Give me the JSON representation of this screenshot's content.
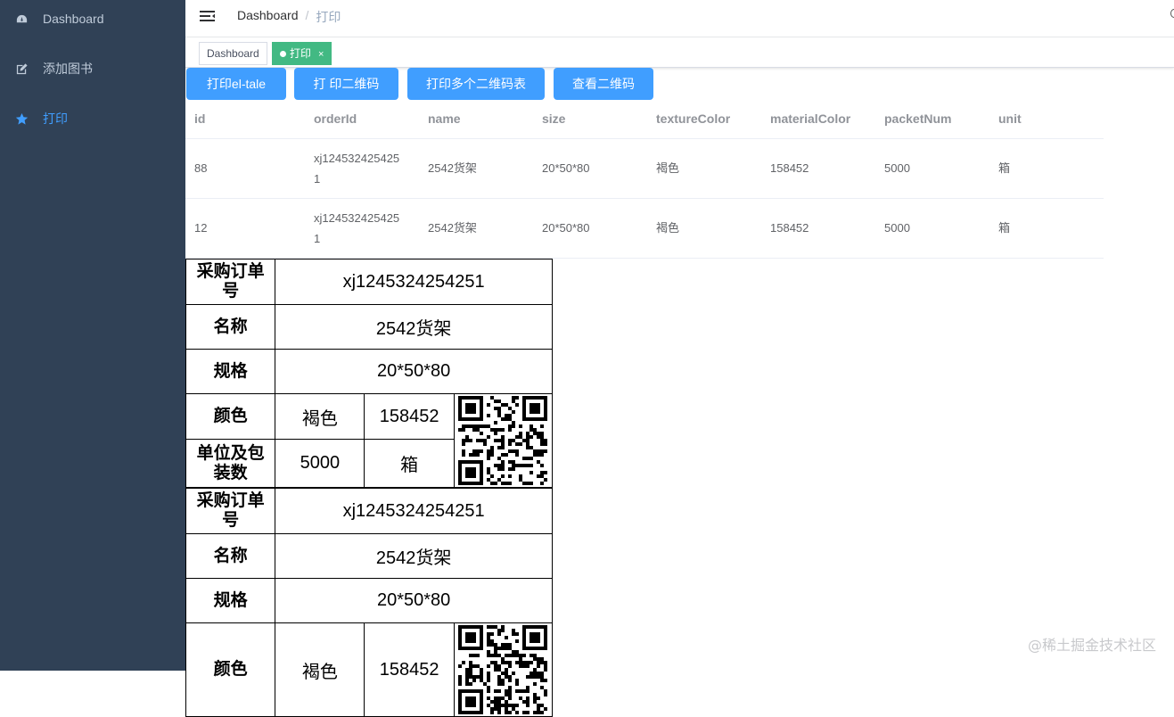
{
  "sidebar": {
    "items": [
      {
        "label": "Dashboard",
        "icon": "dashboard-icon"
      },
      {
        "label": "添加图书",
        "icon": "edit-icon"
      },
      {
        "label": "打印",
        "icon": "star-icon"
      }
    ]
  },
  "navbar": {
    "breadcrumb": [
      "Dashboard",
      "/",
      "打印"
    ]
  },
  "tags": [
    {
      "label": "Dashboard"
    },
    {
      "label": "打印",
      "close": "×"
    }
  ],
  "buttons": [
    "打印el-tale",
    "打 印二维码",
    "打印多个二维码表",
    "查看二维码"
  ],
  "table": {
    "headers": [
      "id",
      "orderId",
      "name",
      "size",
      "textureColor",
      "materialColor",
      "packetNum",
      "unit"
    ],
    "rows": [
      {
        "id": "88",
        "orderId_1": "xj124532425425",
        "orderId_2": "1",
        "name": "2542货架",
        "size": "20*50*80",
        "textureColor": "褐色",
        "materialColor": "158452",
        "packetNum": "5000",
        "unit": "箱"
      },
      {
        "id": "12",
        "orderId_1": "xj124532425425",
        "orderId_2": "1",
        "name": "2542货架",
        "size": "20*50*80",
        "textureColor": "褐色",
        "materialColor": "158452",
        "packetNum": "5000",
        "unit": "箱"
      }
    ]
  },
  "labels": [
    {
      "k_order_1": "采购订单",
      "k_order_2": "号",
      "order": "xj1245324254251",
      "k_name": "名称",
      "name": "2542货架",
      "k_size": "规格",
      "size": "20*50*80",
      "k_color": "颜色",
      "texture": "褐色",
      "material": "158452",
      "k_unit_1": "单位及包",
      "k_unit_2": "装数",
      "packet": "5000",
      "unit": "箱"
    },
    {
      "k_order_1": "采购订单",
      "k_order_2": "号",
      "order": "xj1245324254251",
      "k_name": "名称",
      "name": "2542货架",
      "k_size": "规格",
      "size": "20*50*80",
      "k_color": "颜色",
      "texture": "褐色",
      "material": "158452"
    }
  ],
  "watermark": "@稀土掘金技术社区",
  "colors": {
    "sidebar": "#304156",
    "accent": "#409eff",
    "tag_active": "#42b983"
  }
}
